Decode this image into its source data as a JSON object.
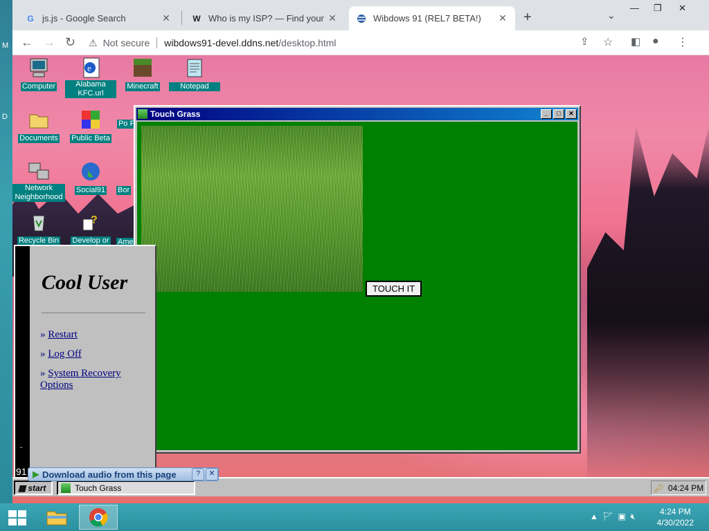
{
  "host": {
    "left_letters": [
      "M",
      "D"
    ],
    "taskbar": {
      "time": "4:24 PM",
      "date": "4/30/2022"
    }
  },
  "browser": {
    "tabs": [
      {
        "title": "js.js - Google Search",
        "icon": "google-icon"
      },
      {
        "title": "Who is my ISP? — Find your Inte",
        "icon": "w-icon"
      },
      {
        "title": "Wibdows 91 (REL7 BETA!)",
        "icon": "wibdows-icon"
      }
    ],
    "new_tab": "+",
    "security": "Not secure",
    "url_host": "wibdows91-devel.ddns.net",
    "url_path": "/desktop.html"
  },
  "desktop": {
    "icons": [
      {
        "label": "Computer",
        "name": "computer"
      },
      {
        "label": "Alabama KFC.url",
        "name": "alabama-kfc"
      },
      {
        "label": "Minecraft",
        "name": "minecraft"
      },
      {
        "label": "Notepad",
        "name": "notepad"
      },
      {
        "label": "Documents",
        "name": "documents"
      },
      {
        "label": "Public Beta",
        "name": "public-beta"
      },
      {
        "label": "Network Neighborhood",
        "name": "network-neighborhood"
      },
      {
        "label": "Social91",
        "name": "social91"
      },
      {
        "label": "Recycle Bin",
        "name": "recycle-bin"
      },
      {
        "label": "Develop or",
        "name": "develop-or"
      }
    ],
    "partial_labels": [
      "Po P",
      "Bor",
      "Ame"
    ]
  },
  "window": {
    "title": "Touch Grass",
    "button": "TOUCH IT"
  },
  "start_menu": {
    "user": "Cool User",
    "items": [
      "Restart",
      "Log Off",
      "System Recovery Options"
    ],
    "arrow": "»",
    "side_text": "91",
    "side_small": "ᵕ"
  },
  "taskbar": {
    "start": "start",
    "task": "Touch Grass",
    "time": "04:24 PM"
  },
  "download_bar": {
    "label": "Download audio from this page",
    "help": "?",
    "close": "✕"
  },
  "colors": {
    "teal": "#008080",
    "window_green": "#008000",
    "title_blue": "#000080"
  }
}
